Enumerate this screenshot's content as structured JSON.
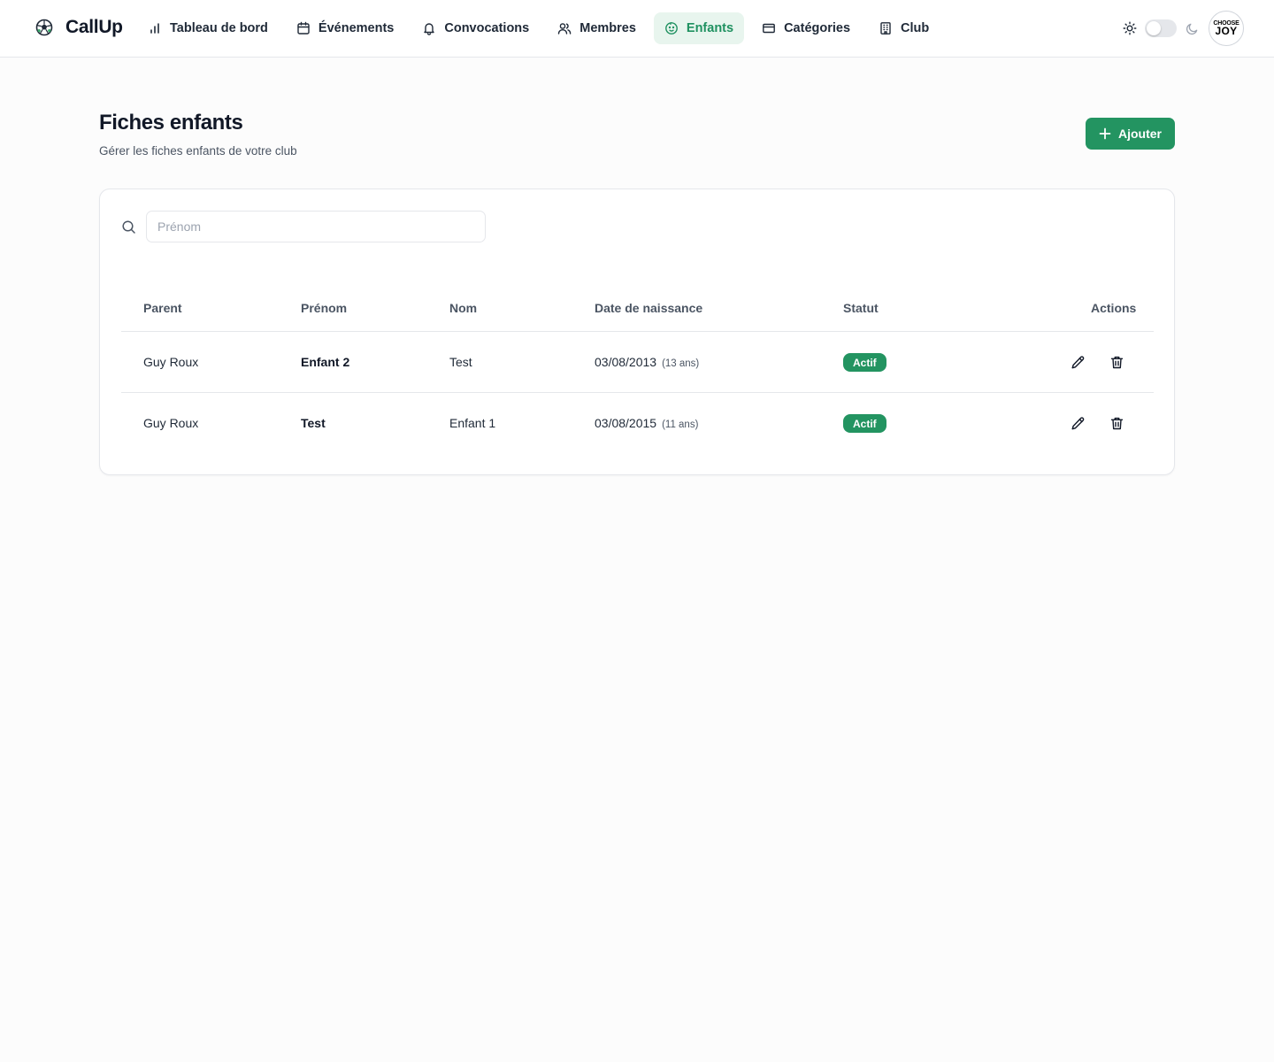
{
  "app": {
    "name": "CallUp"
  },
  "nav": {
    "dashboard": "Tableau de bord",
    "events": "Événements",
    "convocations": "Convocations",
    "members": "Membres",
    "children": "Enfants",
    "categories": "Catégories",
    "club": "Club"
  },
  "colors": {
    "accent": "#239461",
    "nav_active_bg": "#e8f5ee",
    "nav_active_text": "#1f9160"
  },
  "user": {
    "avatar_top": "CHOOSE",
    "avatar_bottom": "JOY"
  },
  "page": {
    "title": "Fiches enfants",
    "subtitle": "Gérer les fiches enfants de votre club",
    "add_label": "Ajouter"
  },
  "search": {
    "placeholder": "Prénom",
    "value": ""
  },
  "table": {
    "headers": {
      "parent": "Parent",
      "prenom": "Prénom",
      "nom": "Nom",
      "date": "Date de naissance",
      "statut": "Statut",
      "actions": "Actions"
    },
    "rows": [
      {
        "parent": "Guy Roux",
        "prenom": "Enfant 2",
        "nom": "Test",
        "date": "03/08/2013",
        "age": "(13 ans)",
        "statut": "Actif"
      },
      {
        "parent": "Guy Roux",
        "prenom": "Test",
        "nom": "Enfant 1",
        "date": "03/08/2015",
        "age": "(11 ans)",
        "statut": "Actif"
      }
    ]
  }
}
